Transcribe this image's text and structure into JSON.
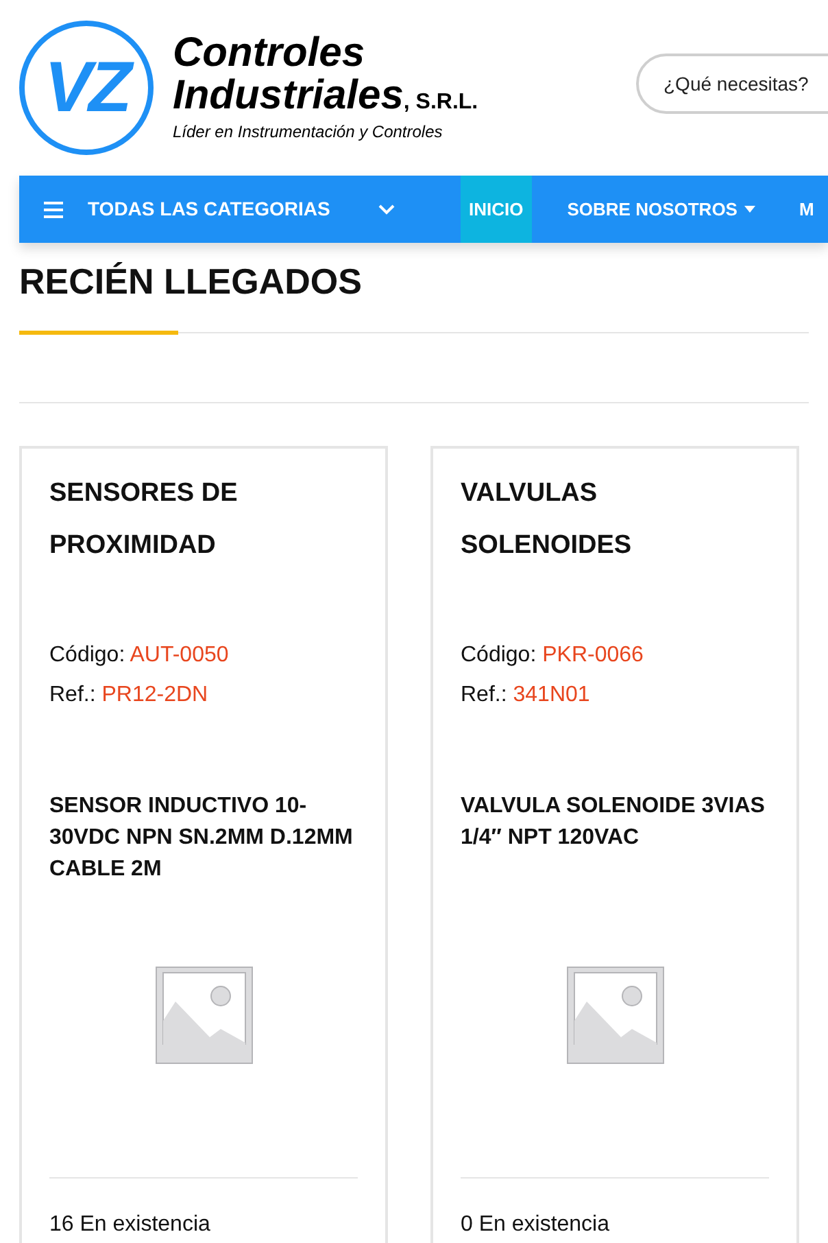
{
  "logo": {
    "mark": "VZ",
    "name_line1": "Controles",
    "name_line2": "Industriales",
    "suffix": ", S.R.L.",
    "tagline": "Líder en Instrumentación y Controles"
  },
  "search": {
    "placeholder": "¿Qué necesitas?"
  },
  "categories": {
    "label": "TODAS LAS CATEGORIAS"
  },
  "nav": [
    {
      "label": "INICIO",
      "selected": true,
      "dropdown": false
    },
    {
      "label": "SOBRE NOSOTROS",
      "selected": false,
      "dropdown": true
    },
    {
      "label": "M",
      "selected": false
    }
  ],
  "section": {
    "title": "RECIÉN LLEGADOS"
  },
  "products": [
    {
      "category": "SENSORES DE PROXIMIDAD",
      "code_label": "Código:",
      "code": "AUT-0050",
      "ref_label": "Ref.:",
      "ref": "PR12-2DN",
      "description": "SENSOR INDUCTIVO 10-30VDC NPN SN.2MM D.12MM CABLE 2M",
      "stock": "16 En existencia"
    },
    {
      "category": "VALVULAS SOLENOIDES",
      "code_label": "Código:",
      "code": "PKR-0066",
      "ref_label": "Ref.:",
      "ref": "341N01",
      "description": "VALVULA SOLENOIDE 3VIAS 1/4″ NPT 120VAC",
      "stock": "0 En existencia"
    }
  ]
}
